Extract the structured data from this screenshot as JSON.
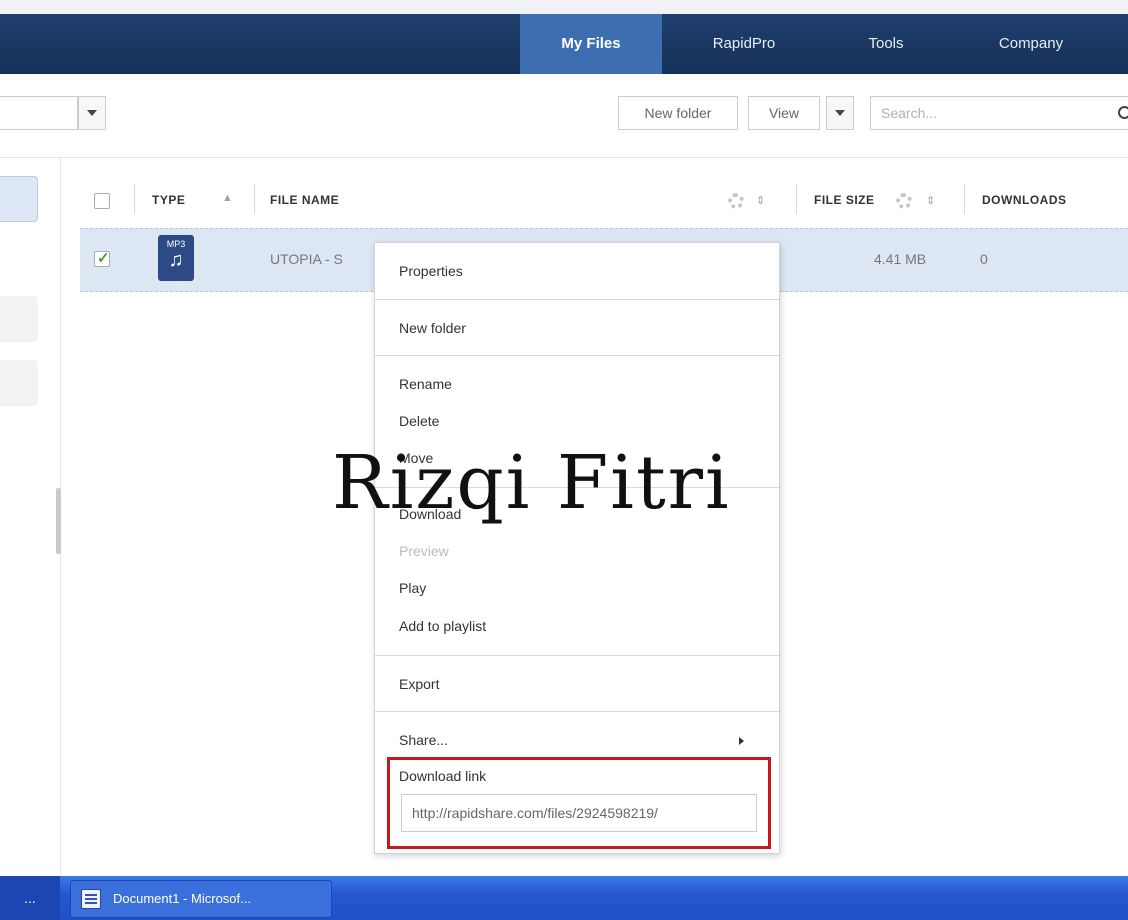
{
  "nav": {
    "tabs": [
      {
        "label": "My Files",
        "active": true
      },
      {
        "label": "RapidPro",
        "active": false
      },
      {
        "label": "Tools",
        "active": false
      },
      {
        "label": "Company",
        "active": false
      }
    ]
  },
  "toolbar": {
    "new_folder_label": "New folder",
    "view_label": "View",
    "search_placeholder": "Search..."
  },
  "table": {
    "columns": [
      "TYPE",
      "FILE NAME",
      "FILE SIZE",
      "DOWNLOADS"
    ],
    "rows": [
      {
        "type": "MP3",
        "file_name": "UTOPIA - S",
        "file_size": "4.41 MB",
        "downloads": "0",
        "selected": true
      }
    ]
  },
  "context_menu": {
    "items": {
      "properties": "Properties",
      "new_folder": "New folder",
      "rename": "Rename",
      "delete": "Delete",
      "move": "Move",
      "download": "Download",
      "preview": "Preview",
      "play": "Play",
      "add_to_playlist": "Add to playlist",
      "export": "Export",
      "share": "Share..."
    },
    "download_link_label": "Download link",
    "download_link_value": "http://rapidshare.com/files/2924598219/"
  },
  "watermark": "Rizqi Fitri",
  "taskbar": {
    "ellipsis": "...",
    "task_label": "Document1 - Microsof..."
  },
  "colors": {
    "nav_bg": "#1f3f6e",
    "nav_active": "#3d6fb0",
    "row_selected": "#dde7f3",
    "highlight_box": "#c8181f",
    "taskbar": "#2457d0"
  }
}
